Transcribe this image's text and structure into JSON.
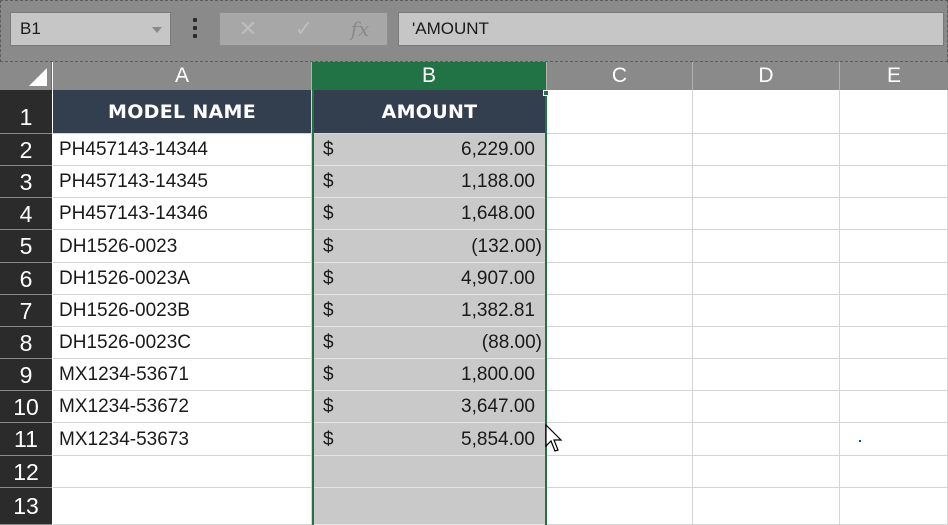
{
  "formula_bar": {
    "name_box": "B1",
    "cancel_symbol": "✕",
    "enter_symbol": "✓",
    "fx_label": "fx",
    "formula": "'AMOUNT"
  },
  "columns": [
    "A",
    "B",
    "C",
    "D",
    "E"
  ],
  "selected_column": "B",
  "rows": [
    "1",
    "2",
    "3",
    "4",
    "5",
    "6",
    "7",
    "8",
    "9",
    "10",
    "11",
    "12",
    "13"
  ],
  "table": {
    "headers": {
      "model": "MODEL NAME",
      "amount": "AMOUNT"
    },
    "currency_symbol": "$",
    "records": [
      {
        "model": "PH457143-14344",
        "amount": "6,229.00 "
      },
      {
        "model": "PH457143-14345",
        "amount": "1,188.00 "
      },
      {
        "model": "PH457143-14346",
        "amount": "1,648.00 "
      },
      {
        "model": "DH1526-0023",
        "amount": "(132.00)"
      },
      {
        "model": "DH1526-0023A",
        "amount": "4,907.00 "
      },
      {
        "model": "DH1526-0023B",
        "amount": "1,382.81 "
      },
      {
        "model": "DH1526-0023C",
        "amount": "(88.00)"
      },
      {
        "model": "MX1234-53671",
        "amount": "1,800.00 "
      },
      {
        "model": "MX1234-53672",
        "amount": "3,647.00 "
      },
      {
        "model": "MX1234-53673",
        "amount": "5,854.00 "
      }
    ]
  },
  "colors": {
    "selection": "#217346",
    "header_fill": "#333f4f",
    "selected_column_fill": "#c9c9c9"
  }
}
